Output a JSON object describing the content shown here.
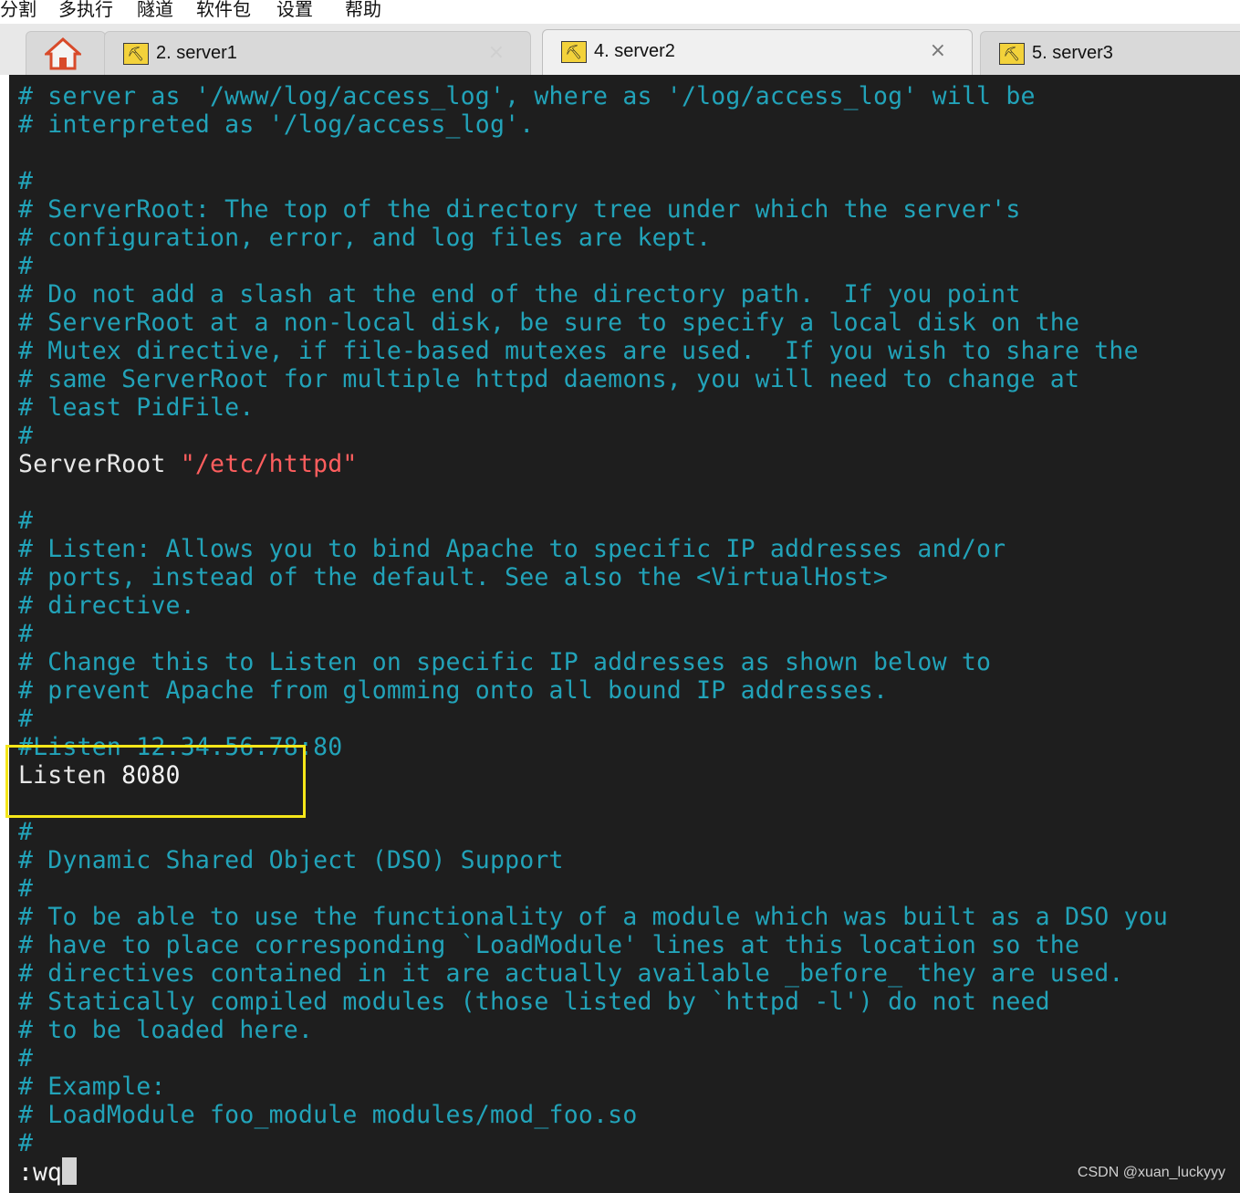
{
  "menu": {
    "items": [
      "分割",
      "多执行",
      "隧道",
      "软件包",
      "设置",
      "帮助"
    ]
  },
  "tabs": [
    {
      "label": "2. server1",
      "close": "×",
      "active": false
    },
    {
      "label": "4. server2",
      "close": "×",
      "active": true
    },
    {
      "label": "5. server3",
      "close": "",
      "active": false
    }
  ],
  "terminal": {
    "lines": [
      "# server as '/www/log/access_log', where as '/log/access_log' will be",
      "# interpreted as '/log/access_log'.",
      "",
      "#",
      "# ServerRoot: The top of the directory tree under which the server's",
      "# configuration, error, and log files are kept.",
      "#",
      "# Do not add a slash at the end of the directory path.  If you point",
      "# ServerRoot at a non-local disk, be sure to specify a local disk on the",
      "# Mutex directive, if file-based mutexes are used.  If you wish to share the",
      "# same ServerRoot for multiple httpd daemons, you will need to change at",
      "# least PidFile.",
      "#"
    ],
    "serverroot_directive": "ServerRoot",
    "serverroot_value": "\"/etc/httpd\"",
    "lines2": [
      "",
      "#",
      "# Listen: Allows you to bind Apache to specific IP addresses and/or",
      "# ports, instead of the default. See also the <VirtualHost>",
      "# directive.",
      "#",
      "# Change this to Listen on specific IP addresses as shown below to",
      "# prevent Apache from glomming onto all bound IP addresses.",
      "#",
      "#Listen 12.34.56.78:80"
    ],
    "listen_directive": "Listen",
    "listen_value": "8080",
    "lines3": [
      "",
      "#",
      "# Dynamic Shared Object (DSO) Support",
      "#",
      "# To be able to use the functionality of a module which was built as a DSO you",
      "# have to place corresponding `LoadModule' lines at this location so the",
      "# directives contained in it are actually available _before_ they are used.",
      "# Statically compiled modules (those listed by `httpd -l') do not need",
      "# to be loaded here.",
      "#",
      "# Example:",
      "# LoadModule foo_module modules/mod_foo.so",
      "#"
    ],
    "command": ":wq"
  },
  "watermark": "CSDN @xuan_luckyyy",
  "colors": {
    "terminal_bg": "#1e1e1e",
    "comment": "#22a3b9",
    "directive": "#e8e8e8",
    "string": "#ff5e5e",
    "highlight_box": "#f5e619"
  }
}
